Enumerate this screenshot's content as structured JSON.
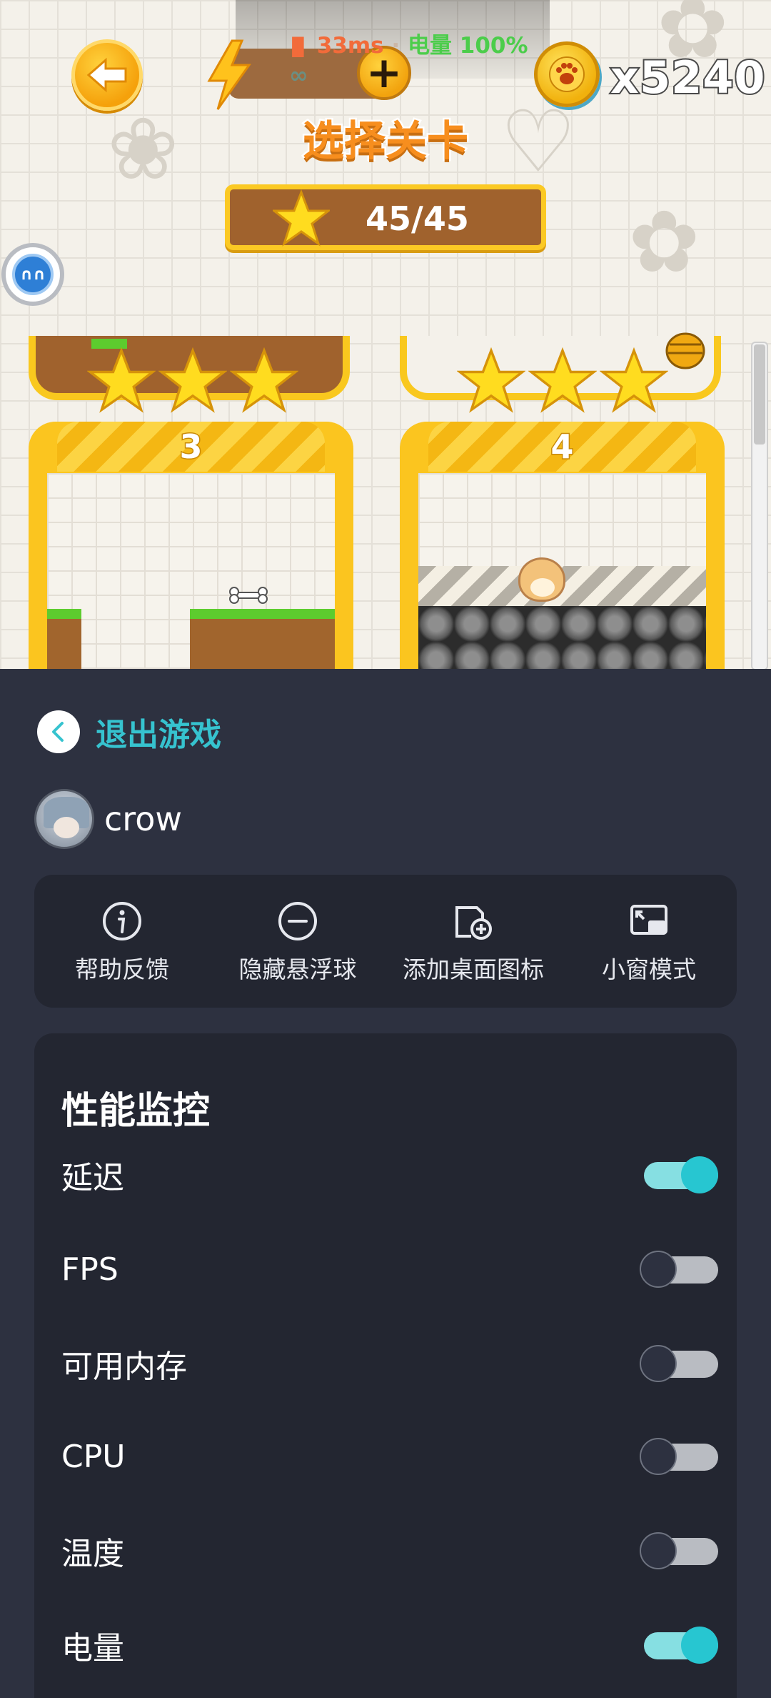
{
  "game": {
    "status": {
      "signal_bars": "▐▌",
      "latency": "33ms",
      "separator": " · ",
      "battery": "电量 100%"
    },
    "energy": "∞",
    "plus": "+",
    "coins": "x5240",
    "title": "选择关卡",
    "score": "45/45",
    "levels": [
      {
        "number": "3"
      },
      {
        "number": "4"
      }
    ]
  },
  "panel": {
    "exit_label": "退出游戏",
    "username": "crow",
    "actions": [
      {
        "label": "帮助反馈",
        "icon": "info-icon"
      },
      {
        "label": "隐藏悬浮球",
        "icon": "minus-circle-icon"
      },
      {
        "label": "添加桌面图标",
        "icon": "add-shortcut-icon"
      },
      {
        "label": "小窗模式",
        "icon": "picture-in-picture-icon"
      }
    ],
    "perf": {
      "title": "性能监控",
      "items": [
        {
          "name": "延迟",
          "on": true
        },
        {
          "name": "FPS",
          "on": false
        },
        {
          "name": "可用内存",
          "on": false
        },
        {
          "name": "CPU",
          "on": false
        },
        {
          "name": "温度",
          "on": false
        },
        {
          "name": "电量",
          "on": true
        }
      ]
    }
  },
  "colors": {
    "accent": "#36c3cf",
    "panel_bg": "#2d3140",
    "card_bg": "#232631",
    "toggle_on": "#27c6d1",
    "toggle_off": "#b9bcc2"
  }
}
